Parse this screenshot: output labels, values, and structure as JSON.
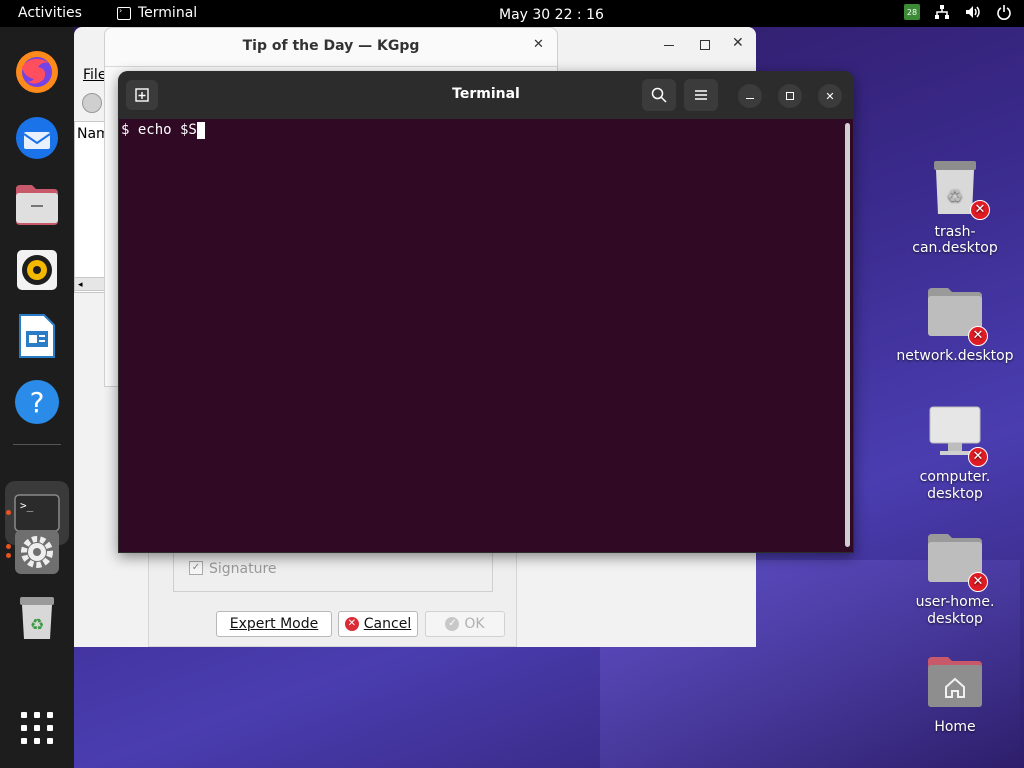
{
  "topbar": {
    "activities": "Activities",
    "app_name": "Terminal",
    "clock": "May 30  22 : 16",
    "tray_icons": [
      "calendar-icon",
      "network-icon",
      "volume-icon",
      "power-icon"
    ],
    "calendar_day": "28"
  },
  "dock": {
    "items": [
      {
        "name": "firefox",
        "icon": "firefox-icon"
      },
      {
        "name": "thunderbird",
        "icon": "thunderbird-icon"
      },
      {
        "name": "files",
        "icon": "files-icon"
      },
      {
        "name": "rhythmbox",
        "icon": "rhythmbox-icon"
      },
      {
        "name": "writer",
        "icon": "libreoffice-writer-icon"
      },
      {
        "name": "help",
        "icon": "help-icon"
      },
      {
        "name": "terminal",
        "icon": "terminal-icon",
        "active": true
      },
      {
        "name": "settings",
        "icon": "settings-icon"
      },
      {
        "name": "trash",
        "icon": "trash-icon"
      },
      {
        "name": "apps",
        "icon": "show-apps-icon"
      }
    ]
  },
  "kgpg_main": {
    "menu_file": "File",
    "column_name": "Nam"
  },
  "tip_window": {
    "title": "Tip of the Day — KGpg"
  },
  "kgpg_dialog": {
    "signature_label": "Signature",
    "expert_mode": "Expert Mode",
    "cancel": "Cancel",
    "ok": "OK"
  },
  "terminal": {
    "title": "Terminal",
    "prompt_line": "$ echo $S"
  },
  "desktop": {
    "icons": [
      {
        "label": "trash-can.desktop"
      },
      {
        "label": "network.desktop"
      },
      {
        "label": "computer.\ndesktop"
      },
      {
        "label": "user-home.\ndesktop"
      },
      {
        "label": "Home"
      }
    ]
  },
  "colors": {
    "terminal_bg": "#300a24",
    "titlebar": "#2c2c2c",
    "accent": "#e95420",
    "error_badge": "#e01b24"
  }
}
